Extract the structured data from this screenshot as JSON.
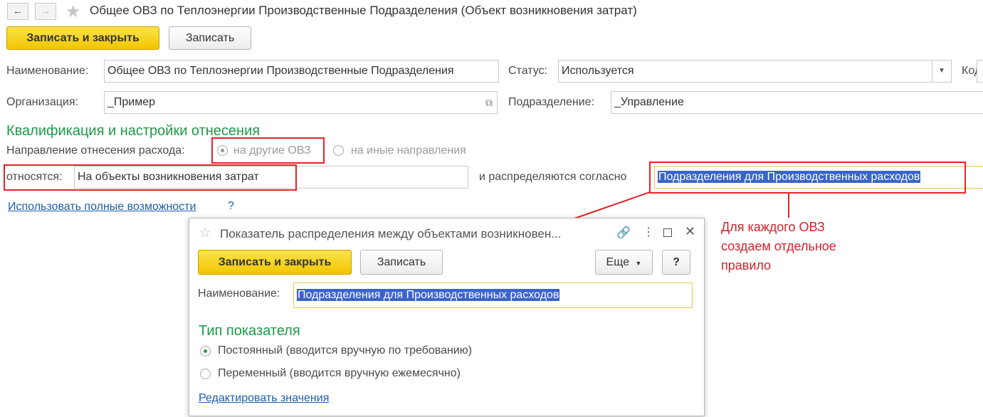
{
  "window": {
    "title": "Общее ОВЗ по Теплоэнергии Производственные Подразделения (Объект возникновения затрат)",
    "back_icon": "arrow-left",
    "forward_icon": "arrow-right",
    "star_icon": "star"
  },
  "toolbar": {
    "save_close_label": "Записать и закрыть",
    "save_label": "Записать"
  },
  "form": {
    "name_label": "Наименование:",
    "name_value": "Общее ОВЗ по Теплоэнергии Производственные Подразделения",
    "status_label": "Статус:",
    "status_value": "Используется",
    "code_label": "Код",
    "org_label": "Организация:",
    "org_value": "_Пример",
    "dept_label": "Подразделение:",
    "dept_value": "_Управление"
  },
  "qualification": {
    "heading": "Квалификация и настройки отнесения",
    "direction_label": "Направление отнесения расхода:",
    "option_other_ovz": "на другие ОВЗ",
    "option_other_directions": "на иные направления",
    "relates_label": "относятся:",
    "relates_value": "На объекты возникновения затрат",
    "distributed_label": "и распределяются согласно",
    "distributed_value": "Подразделения для Производственных расходов",
    "full_features_link": "Использовать полные возможности",
    "help_mark": "?"
  },
  "annotation": {
    "line1": "Для каждого ОВЗ",
    "line2": "создаем отдельное",
    "line3": "правило",
    "color": "#d6222a"
  },
  "dialog": {
    "title": "Показатель распределения между объектами возникновен...",
    "save_close_label": "Записать и закрыть",
    "save_label": "Записать",
    "more_label": "Еще",
    "help_label": "?",
    "name_label": "Наименование:",
    "name_value": "Подразделения для Производственных расходов",
    "type_heading": "Тип показателя",
    "option_constant": "Постоянный (вводится вручную по требованию)",
    "option_variable": "Переменный (вводится вручную ежемесячно)",
    "edit_values_link": "Редактировать значения"
  },
  "colors": {
    "accent_yellow": "#f2c500",
    "section_green": "#1d9a46",
    "link_blue": "#1c5fa8",
    "highlight_red": "#e2242a",
    "selection_blue": "#3a64c8"
  }
}
